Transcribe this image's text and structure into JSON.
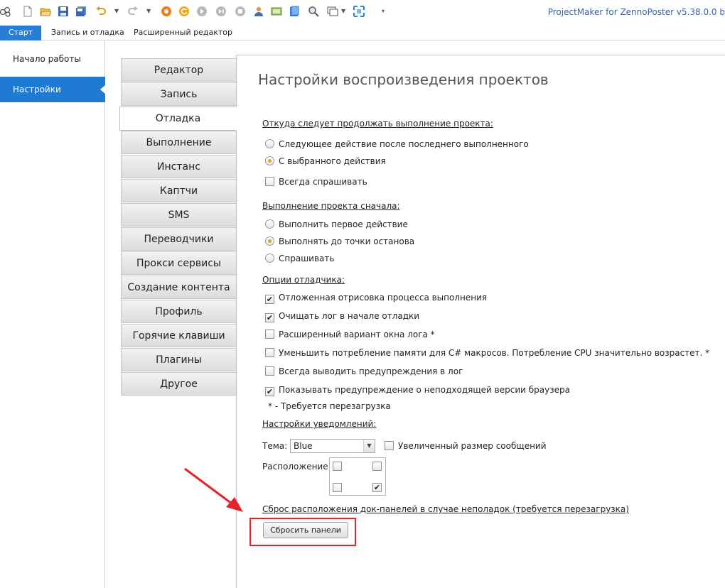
{
  "app": {
    "title": "ProjectMaker for ZennoPoster v5.38.0.0 b"
  },
  "toolbar": {
    "icons": [
      "logo-icon",
      "new-file-icon",
      "open-folder-icon",
      "save-icon",
      "save-all-icon",
      "undo-icon",
      "redo-icon",
      "record-icon",
      "refresh-icon",
      "play-icon",
      "step-icon",
      "stop-icon",
      "user-icon",
      "screen-icon",
      "book-icon",
      "search-icon",
      "window-icon",
      "fullscreen-icon",
      "overflow-icon"
    ]
  },
  "ribbon": {
    "tabs": [
      "Старт",
      "Запись и отладка",
      "Расширенный редактор"
    ]
  },
  "leftnav": {
    "items": [
      "Начало работы",
      "Настройки"
    ]
  },
  "categories": [
    "Редактор",
    "Запись",
    "Отладка",
    "Выполнение",
    "Инстанс",
    "Каптчи",
    "SMS",
    "Переводчики",
    "Прокси сервисы",
    "Создание контента",
    "Профиль",
    "Горячие клавиши",
    "Плагины",
    "Другое"
  ],
  "content": {
    "title": "Настройки воспроизведения проектов",
    "section_continue": "Откуда следует продолжать выполнение проекта:",
    "opt_next": "Следующее действие после последнего выполненного",
    "opt_selected": "С выбранного действия",
    "opt_always_ask": "Всегда спрашивать",
    "section_start": "Выполнение проекта сначала:",
    "opt_first": "Выполнить первое действие",
    "opt_breakpoint": "Выполнять до точки останова",
    "opt_ask": "Спрашивать",
    "section_debugger": "Опции отладчика:",
    "dbg_1": "Отложенная отрисовка процесса выполнения",
    "dbg_2": "Очищать лог в начале отладки",
    "dbg_3": "Расширенный вариант окна лога *",
    "dbg_4": "Уменьшить потребление памяти для C# макросов. Потребление CPU значительно возрастет. *",
    "dbg_5": "Всегда выводить предупреждения в лог",
    "dbg_6": "Показывать предупреждение о неподходящей версии браузера",
    "restart_note": "* - Требуется перезагрузка",
    "section_notify": "Настройки уведомлений:",
    "theme_label": "Тема:",
    "theme_value": "Blue",
    "bigmsg_label": "Увеличенный размер сообщений",
    "position_label": "Расположение:",
    "reset_title": "Сброс расположения док-панелей в случае неполадок (требуется перезагрузка)",
    "reset_button": "Сбросить панели"
  },
  "state": {
    "continue_selected": "С выбранного действия",
    "start_selected": "Выполнять до точки останова",
    "always_ask": false,
    "debugger_checked": [
      true,
      true,
      false,
      false,
      false,
      true
    ],
    "bigmsg": false,
    "position_checked": {
      "top_left": false,
      "top_right": false,
      "bottom_left": false,
      "bottom_right": true
    }
  },
  "colors": {
    "accent": "#1f7ad1",
    "radio_dot": "#e5a21b",
    "highlight": "#e3242b",
    "title": "#3d63a0"
  }
}
